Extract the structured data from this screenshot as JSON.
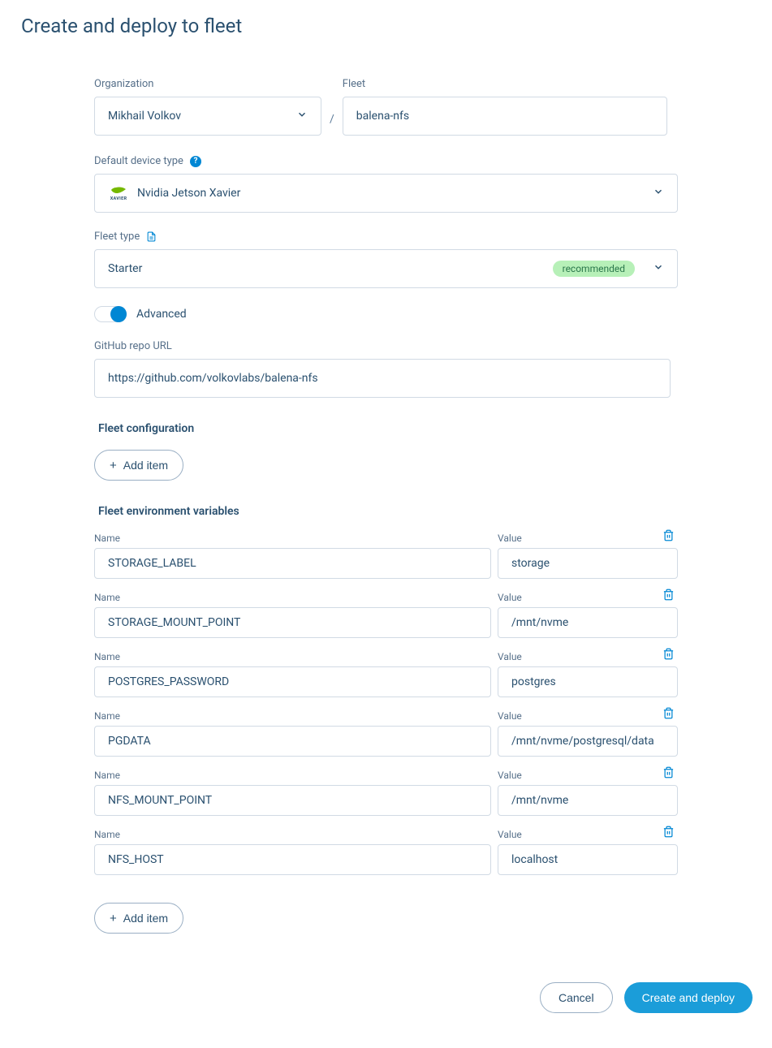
{
  "page": {
    "title": "Create and deploy to fleet"
  },
  "labels": {
    "organization": "Organization",
    "fleet": "Fleet",
    "default_device_type": "Default device type",
    "fleet_type": "Fleet type",
    "advanced": "Advanced",
    "github_repo_url": "GitHub repo URL",
    "fleet_configuration": "Fleet configuration",
    "fleet_env_vars": "Fleet environment variables",
    "name": "Name",
    "value": "Value",
    "add_item": "Add item"
  },
  "form": {
    "organization": "Mikhail Volkov",
    "fleet_name": "balena-nfs",
    "device_type": "Nvidia Jetson Xavier",
    "device_logo_sub": "XAVIER",
    "fleet_type": "Starter",
    "fleet_type_badge": "recommended",
    "advanced_on": true,
    "github_repo_url": "https://github.com/volkovlabs/balena-nfs"
  },
  "env_vars": [
    {
      "name": "STORAGE_LABEL",
      "value": "storage"
    },
    {
      "name": "STORAGE_MOUNT_POINT",
      "value": "/mnt/nvme"
    },
    {
      "name": "POSTGRES_PASSWORD",
      "value": "postgres"
    },
    {
      "name": "PGDATA",
      "value": "/mnt/nvme/postgresql/data"
    },
    {
      "name": "NFS_MOUNT_POINT",
      "value": "/mnt/nvme"
    },
    {
      "name": "NFS_HOST",
      "value": "localhost"
    }
  ],
  "buttons": {
    "cancel": "Cancel",
    "submit": "Create and deploy"
  }
}
